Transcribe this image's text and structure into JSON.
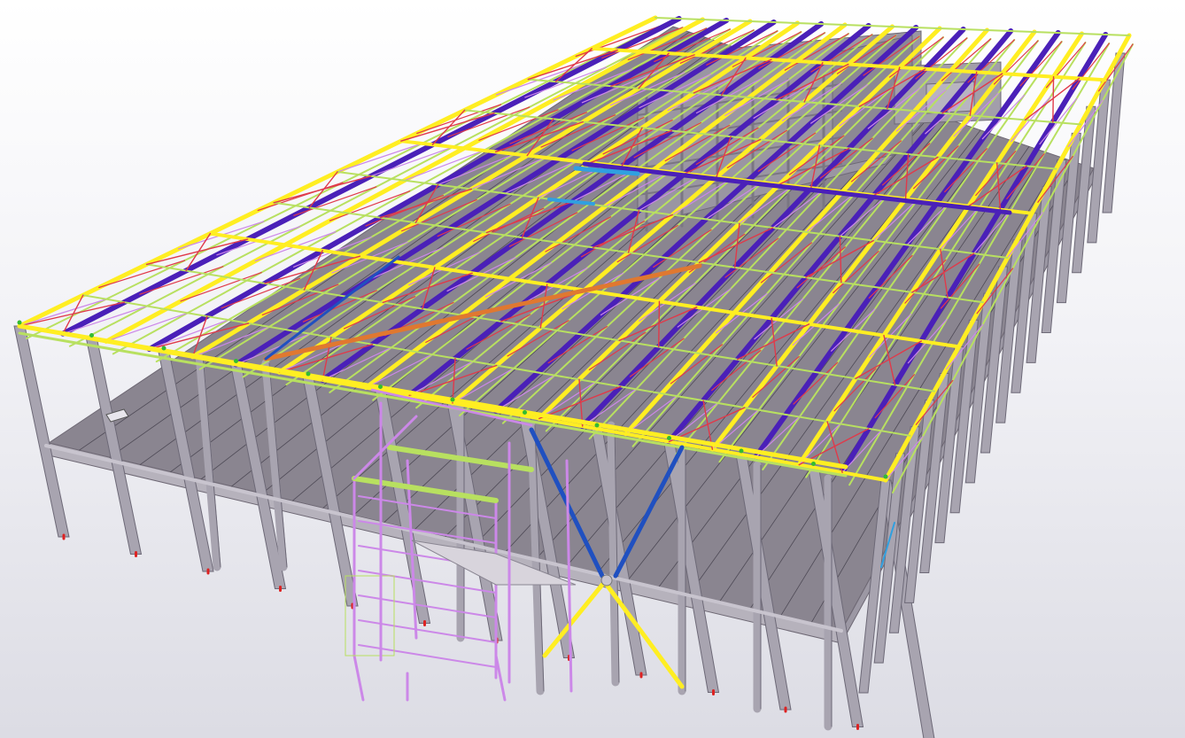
{
  "viewport": {
    "background_top": "#ffffff",
    "background_bottom": "#dcdce4"
  },
  "colors": {
    "slab": "#8a8590",
    "slab_edge": "#6e6874",
    "column": "#a8a4b0",
    "column_edge": "#6d6977",
    "beam_yellow": "#ffee22",
    "beam_purple": "#4a20b8",
    "brace_red": "#e03a4a",
    "brace_blue": "#2050c0",
    "member_pink": "#cc88e8",
    "member_green": "#b8e060",
    "beam_orange": "#e07830",
    "member_cyan": "#30a0e0",
    "anchor_green": "#33bb33",
    "anchor_red": "#dd2222",
    "core_block": "#9a96a2"
  },
  "model": {
    "description_visible": false,
    "elements": [
      "ground-floor-slab",
      "perimeter-columns",
      "roof-trusses",
      "purlins",
      "bracing",
      "stair-tower",
      "central-core"
    ]
  }
}
